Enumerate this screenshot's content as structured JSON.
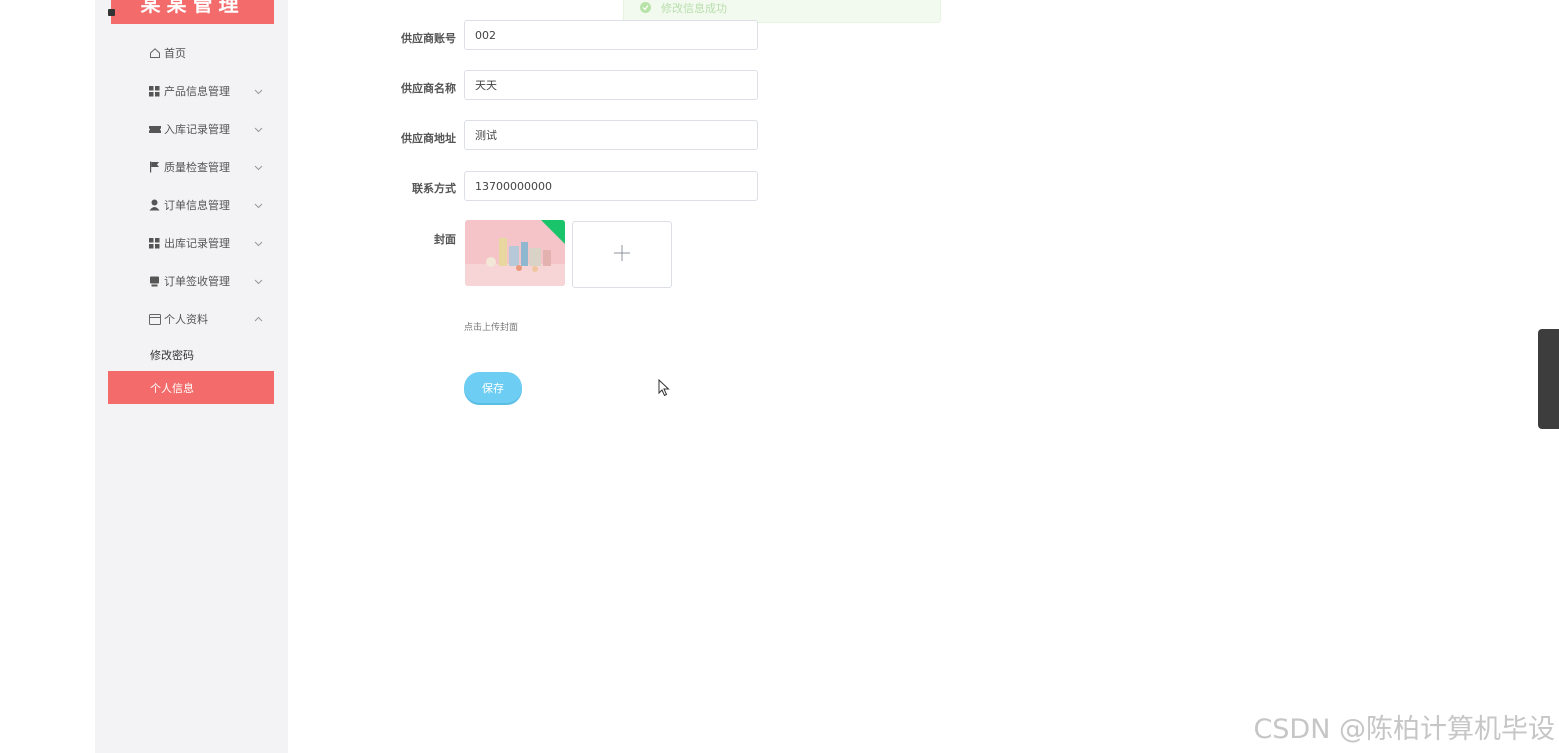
{
  "sidebar": {
    "brand": "某某管理",
    "items": [
      {
        "label": "首页",
        "icon": "home-icon"
      },
      {
        "label": "产品信息管理",
        "icon": "grid-icon"
      },
      {
        "label": "入库记录管理",
        "icon": "ticket-icon"
      },
      {
        "label": "质量检查管理",
        "icon": "flag-icon"
      },
      {
        "label": "订单信息管理",
        "icon": "user-icon"
      },
      {
        "label": "出库记录管理",
        "icon": "grid-icon"
      },
      {
        "label": "订单签收管理",
        "icon": "stamp-icon"
      },
      {
        "label": "个人资料",
        "icon": "card-icon"
      }
    ],
    "sub_items": [
      {
        "label": "修改密码"
      },
      {
        "label": "个人信息"
      }
    ]
  },
  "toast": {
    "message": "修改信息成功"
  },
  "form": {
    "fields": [
      {
        "label": "供应商账号",
        "value": "002"
      },
      {
        "label": "供应商名称",
        "value": "天天"
      },
      {
        "label": "供应商地址",
        "value": "测试"
      },
      {
        "label": "联系方式",
        "value": "13700000000"
      }
    ],
    "cover_label": "封面",
    "upload_hint": "点击上传封面",
    "save_label": "保存"
  },
  "watermark": "CSDN @陈柏计算机毕设",
  "colors": {
    "accent": "#f46b6b",
    "button": "#6ecdf3",
    "success": "#67c23a"
  }
}
